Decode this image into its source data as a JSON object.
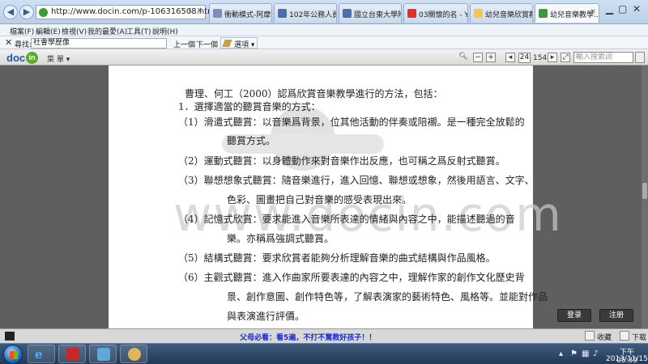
{
  "browser": {
    "url": "http://www.docin.com/p-106316508.html",
    "tabs": [
      {
        "label": "衝動模式-阿摩書..."
      },
      {
        "label": "102年公務人員特..."
      },
      {
        "label": "國立台東大學附設..."
      },
      {
        "label": "03關懷的名 - You..."
      },
      {
        "label": "幼兒音樂欣賞教學..."
      },
      {
        "label": "幼兒音樂教學..."
      }
    ],
    "menu": [
      "檔案(F)",
      "編輯(E)",
      "檢視(V)",
      "我的最愛(A)",
      "工具(T)",
      "說明(H)"
    ],
    "find": {
      "label": "尋找:",
      "value": "社會學歷像",
      "prev": "上一個",
      "next": "下一個",
      "options": "選項"
    }
  },
  "viewer": {
    "logo_text": "doc",
    "logo_badge": "in",
    "menu_label": "菜 單 ▾",
    "current_page": "24",
    "total_pages": "154",
    "search_placeholder": "輸入搜索詞",
    "zoom_out": "−",
    "zoom_in": "+",
    "prev_page": "◂",
    "next_page": "▸"
  },
  "document": {
    "watermark": "www.docin.com",
    "lines": [
      "曹理、何工（2000）認爲欣賞音樂教學進行的方法，包括：",
      "1．選擇適當的聽賞音樂的方式：",
      "（1）滑遣式聽賞：以音樂爲背景，位其他活動的伴奏或陪襯。是一種完全放鬆的",
      "聽賞方式。",
      "（2）運動式聽賞：以身體動作來對音樂作出反應，也可稱之爲反射式聽賞。",
      "（3）聯想想象式聽賞：隨音樂進行，進入回憶、聯想或想象，然後用語言、文字、",
      "色彩、圖畫把自己對音樂的感受表現出來。",
      "（4）記憶式欣賞：要求能進入音樂所表達的情緒與內容之中，能描述聽過的音",
      "樂。亦稱爲強調式聽賞。",
      "（5）結構式聽賞：要求欣賞者能夠分析理解音樂的曲式結構與作品風格。",
      "（6）主觀式聽賞：進入作曲家所要表達的內容之中，理解作家的創作文化歷史背",
      "景、創作意圖、創作特色等，了解表演家的藝術特色、風格等。並能對作品",
      "與表演進行評價。"
    ]
  },
  "actions": {
    "login": "登录",
    "register": "注册"
  },
  "bottombar": {
    "marquee": "父母必看：看5遍，不打不罵教好孩子！！",
    "favorite": "收藏",
    "download": "下载"
  },
  "taskbar": {
    "time": "下午 05:39",
    "date": "2013/11/15"
  },
  "colors": {
    "ie_chrome": "#c9dcf0",
    "viewer_bg": "#5f5f5f",
    "docin_blue": "#1c5aa6",
    "docin_green": "#5aab2a",
    "marquee_text": "#1a2ccc"
  }
}
